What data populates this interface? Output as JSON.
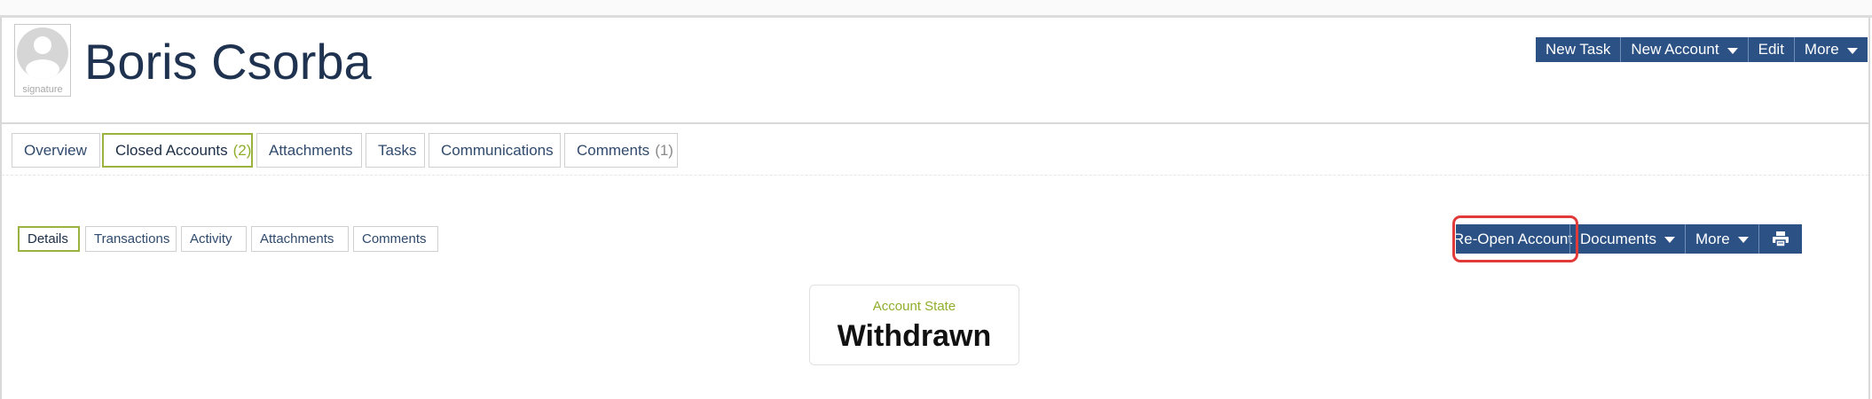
{
  "person": {
    "name": "Boris Csorba",
    "avatar_caption": "signature"
  },
  "header_actions": {
    "new_task": "New Task",
    "new_account": "New Account",
    "edit": "Edit",
    "more": "More"
  },
  "main_tabs": [
    {
      "label": "Overview"
    },
    {
      "label": "Closed Accounts",
      "count": "(2)"
    },
    {
      "label": "Attachments"
    },
    {
      "label": "Tasks"
    },
    {
      "label": "Communications"
    },
    {
      "label": "Comments",
      "count": "(1)"
    }
  ],
  "sub_tabs": [
    {
      "label": "Details"
    },
    {
      "label": "Transactions"
    },
    {
      "label": "Activity"
    },
    {
      "label": "Attachments"
    },
    {
      "label": "Comments"
    }
  ],
  "account_actions": {
    "reopen": "Re-Open Account",
    "documents": "Documents",
    "more": "More"
  },
  "account_state": {
    "label": "Account State",
    "value": "Withdrawn"
  },
  "colors": {
    "primary": "#2b5185",
    "accent_green": "#9ab33e",
    "highlight_red": "#e03a3a",
    "title_navy": "#1f3350"
  },
  "icons": {
    "avatar": "person-silhouette-icon",
    "dropdown": "caret-down-icon",
    "print": "printer-icon"
  }
}
